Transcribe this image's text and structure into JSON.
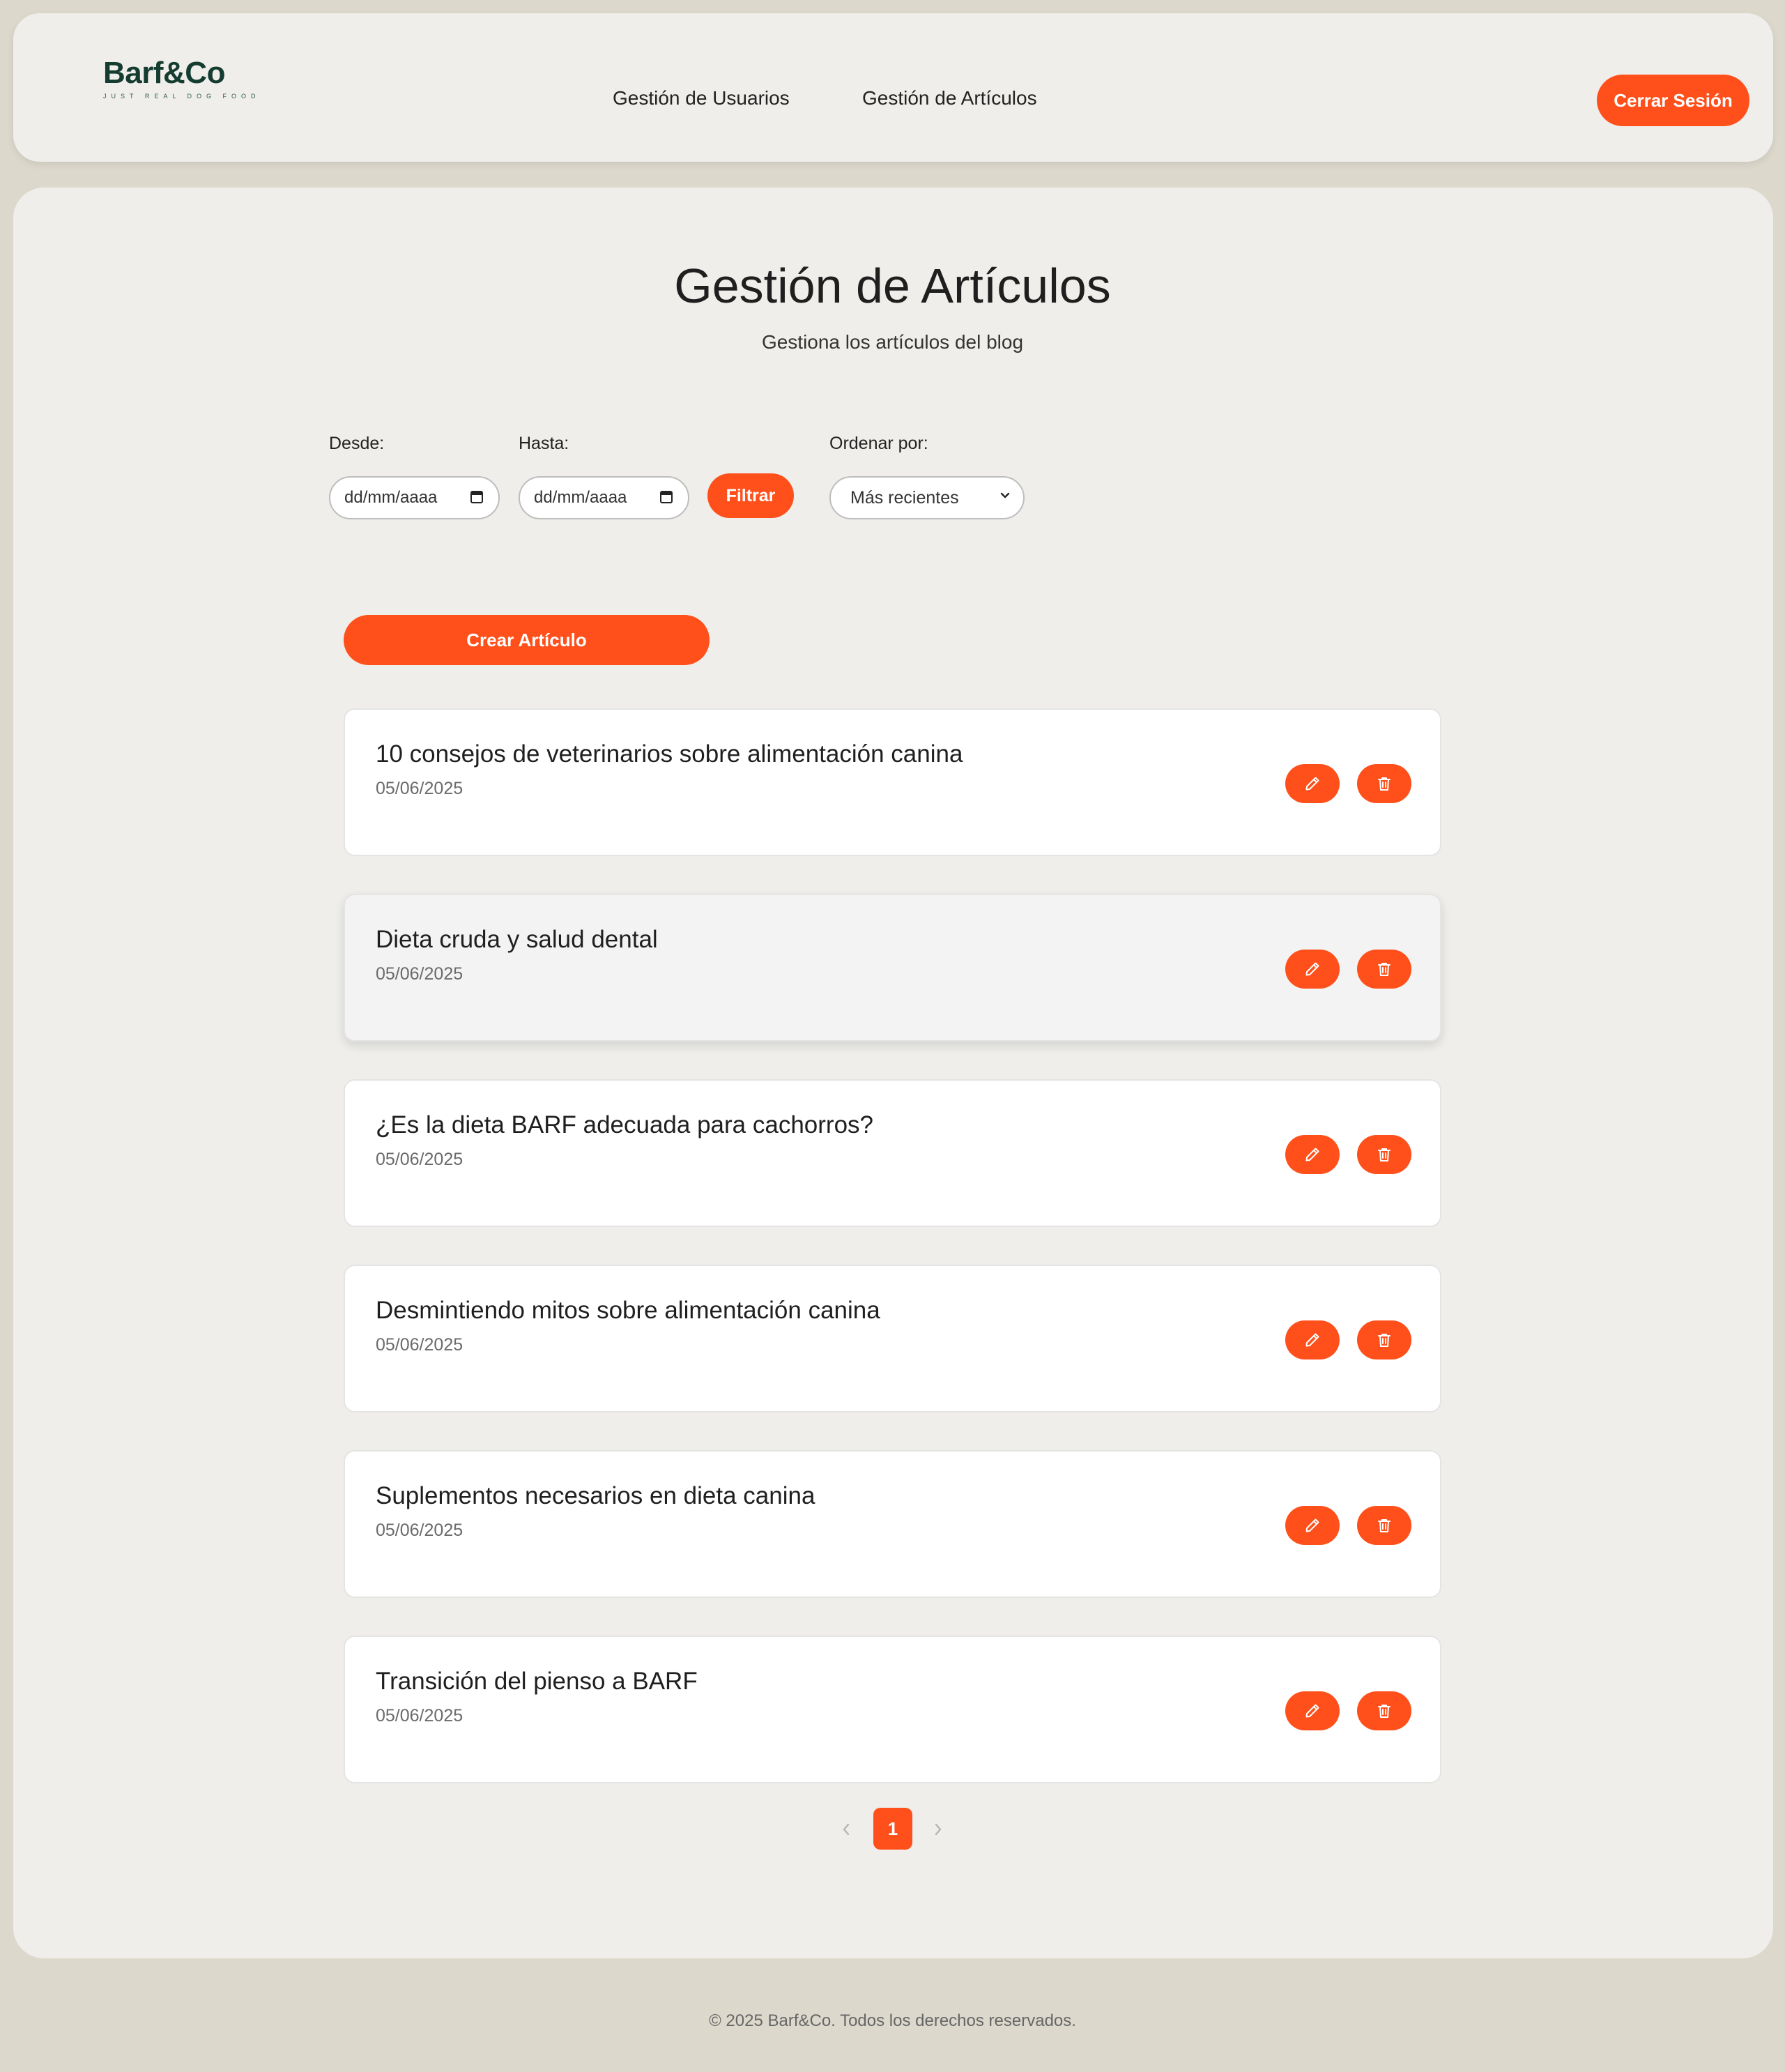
{
  "brand": {
    "name": "Barf&Co",
    "tagline": "JUST REAL DOG FOOD"
  },
  "nav": {
    "items": [
      {
        "label": "Gestión de Usuarios"
      },
      {
        "label": "Gestión de Artículos"
      }
    ],
    "logout_label": "Cerrar Sesión"
  },
  "page": {
    "title": "Gestión de Artículos",
    "subtitle": "Gestiona los artículos del blog"
  },
  "filters": {
    "from_label": "Desde:",
    "from_placeholder": "dd/mm/aaaa",
    "to_label": "Hasta:",
    "to_placeholder": "dd/mm/aaaa",
    "filter_button": "Filtrar",
    "sort_label": "Ordenar por:",
    "sort_selected": "Más recientes"
  },
  "create_button": "Crear Artículo",
  "articles": [
    {
      "title": "10 consejos de veterinarios sobre alimentación canina",
      "date": "05/06/2025"
    },
    {
      "title": "Dieta cruda y salud dental",
      "date": "05/06/2025"
    },
    {
      "title": "¿Es la dieta BARF adecuada para cachorros?",
      "date": "05/06/2025"
    },
    {
      "title": "Desmintiendo mitos sobre alimentación canina",
      "date": "05/06/2025"
    },
    {
      "title": "Suplementos necesarios en dieta canina",
      "date": "05/06/2025"
    },
    {
      "title": "Transición del pienso a BARF",
      "date": "05/06/2025"
    }
  ],
  "pagination": {
    "current_page": "1"
  },
  "footer": {
    "text": "© 2025 Barf&Co. Todos los derechos reservados."
  },
  "colors": {
    "accent": "#ff4f1a",
    "background": "#dcd8cc",
    "panel": "#efeeea",
    "brand": "#153c31"
  }
}
